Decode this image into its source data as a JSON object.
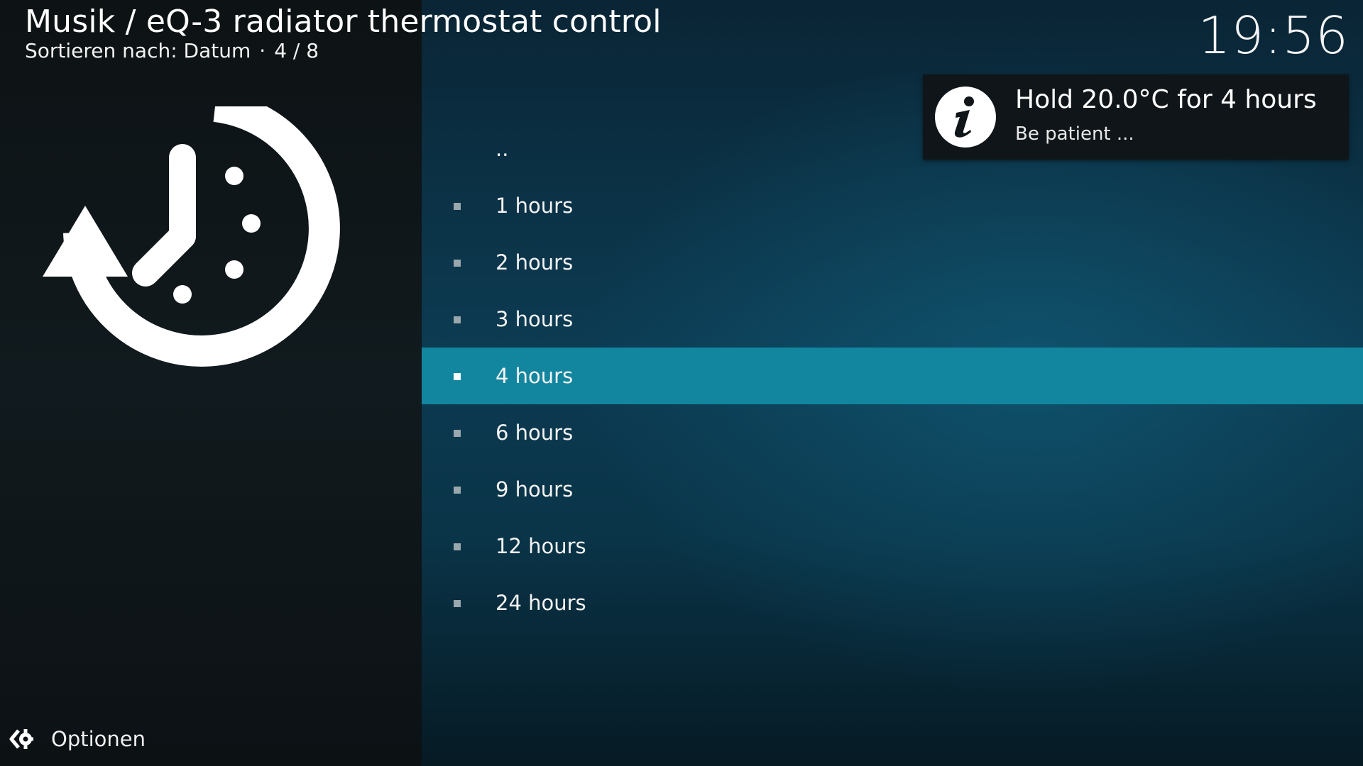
{
  "header": {
    "title": "Musik / eQ-3 radiator thermostat control",
    "sort_label": "Sortieren nach: Datum",
    "separator": "·",
    "position": "4 / 8"
  },
  "clock": "19:56",
  "thumbnail": {
    "icon": "clock-history-icon"
  },
  "list": {
    "parent": "..",
    "items": [
      {
        "label": "1 hours"
      },
      {
        "label": "2 hours"
      },
      {
        "label": "3 hours"
      },
      {
        "label": "4 hours",
        "selected": true
      },
      {
        "label": "6 hours"
      },
      {
        "label": "9 hours"
      },
      {
        "label": "12 hours"
      },
      {
        "label": "24 hours"
      }
    ]
  },
  "notification": {
    "icon": "info-icon",
    "title": "Hold 20.0°C for 4 hours",
    "message": "Be patient ..."
  },
  "footer": {
    "options_icon": "options-gear-icon",
    "options_label": "Optionen"
  },
  "colors": {
    "accent": "#12869f",
    "panel_dark": "#0f1518",
    "background": "#0c3b52"
  }
}
